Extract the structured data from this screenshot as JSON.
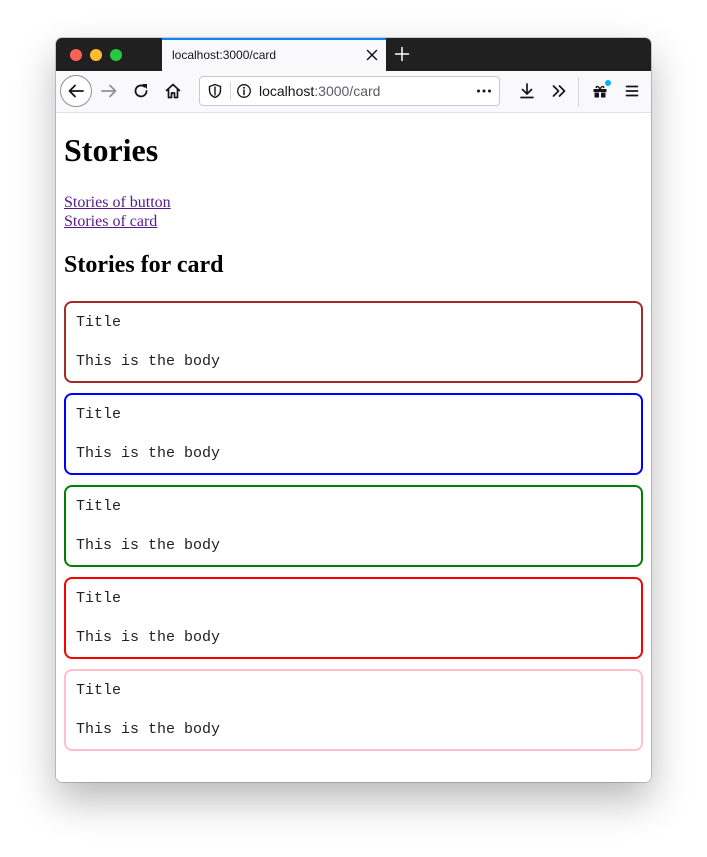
{
  "tab": {
    "title": "localhost:3000/card"
  },
  "urlbar": {
    "host": "localhost",
    "path": ":3000/card"
  },
  "icons": {
    "tab_close": "close-icon",
    "new_tab": "plus-icon",
    "back": "arrow-left-icon",
    "forward": "arrow-right-icon",
    "reload": "reload-icon",
    "home": "home-icon",
    "tracking_protection": "shield-icon",
    "site_info": "info-icon",
    "page_actions": "more-horizontal-icon",
    "downloads": "download-icon",
    "overflow": "chevron-double-right-icon",
    "extensions": "gift-icon",
    "menu": "hamburger-menu-icon"
  },
  "page": {
    "heading": "Stories",
    "links": [
      {
        "label": "Stories of button"
      },
      {
        "label": "Stories of card"
      }
    ],
    "section_heading": "Stories for card"
  },
  "cards": [
    {
      "title": "Title",
      "body": "This is the body",
      "border_color": "#a52a2a"
    },
    {
      "title": "Title",
      "body": "This is the body",
      "border_color": "#0000ff"
    },
    {
      "title": "Title",
      "body": "This is the body",
      "border_color": "#008000"
    },
    {
      "title": "Title",
      "body": "This is the body",
      "border_color": "#ff0000"
    },
    {
      "title": "Title",
      "body": "This is the body",
      "border_color": "#ffc0cb"
    }
  ],
  "colors": {
    "tab_accent": "#0a84ff",
    "link_visited": "#551a8b",
    "tabstrip_bg": "#202020"
  }
}
